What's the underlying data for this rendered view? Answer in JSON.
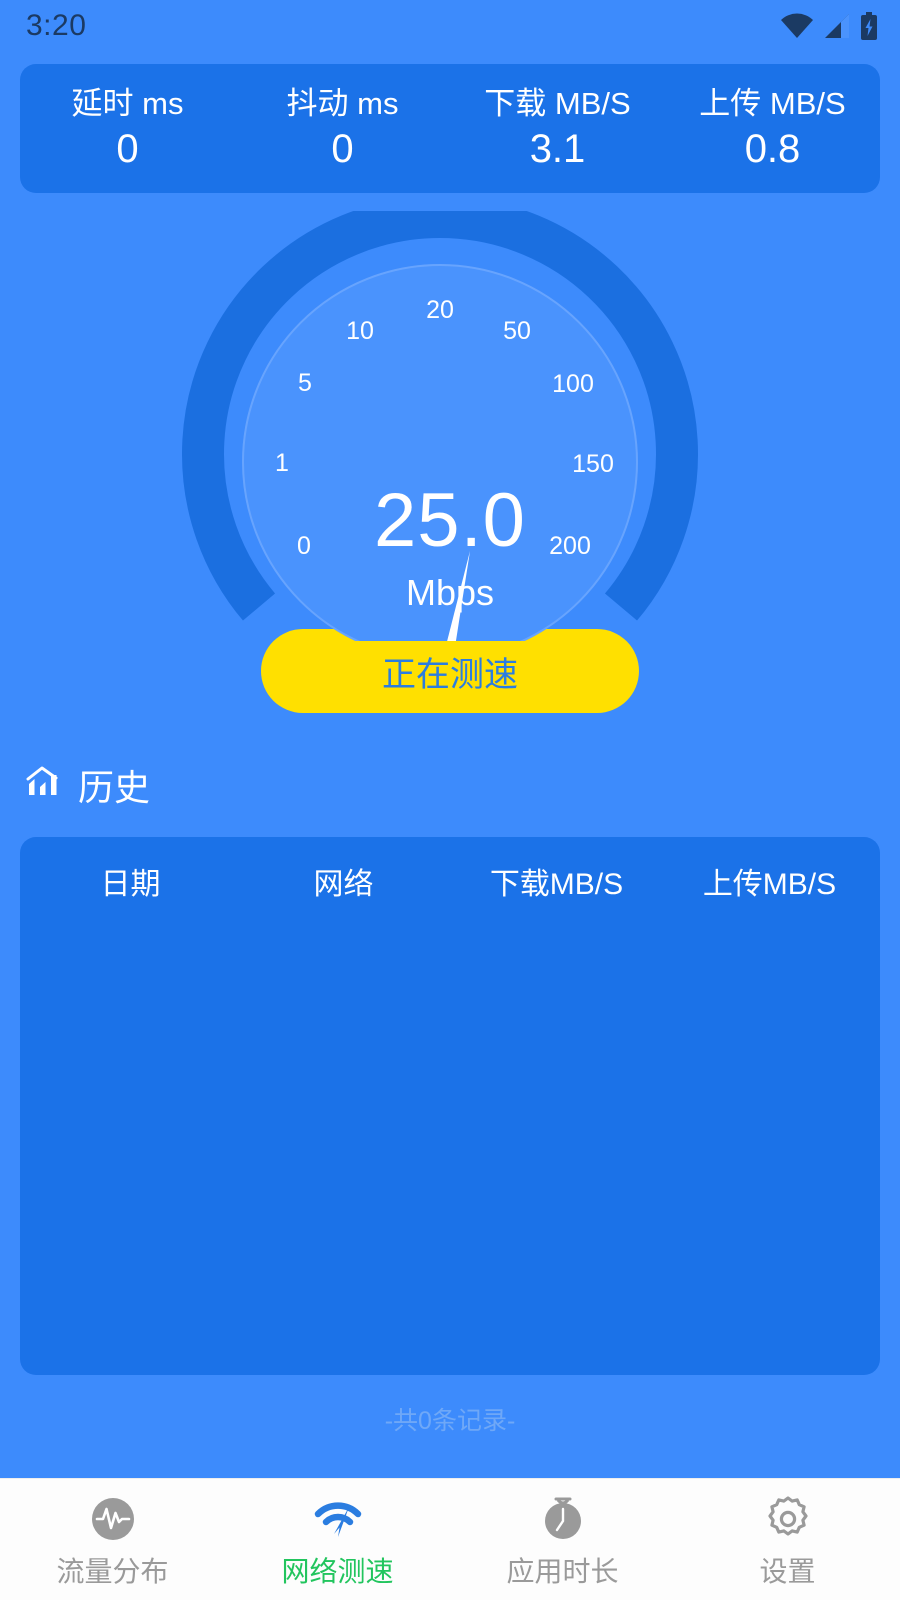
{
  "status_bar": {
    "clock": "3:20",
    "icons": [
      "wifi-icon",
      "cellular-signal-icon",
      "battery-charging-icon"
    ]
  },
  "colors": {
    "page_background": "#3d8bfc",
    "card_background": "#1b72e8",
    "accent_button": "#ffe000",
    "button_text": "#2b7de0",
    "active_tab": "#22c55e",
    "inactive_tab": "#9a9a9a",
    "gauge_arc": "#1b6fe0",
    "gauge_face": "#4a93fd",
    "needle": "#ffffff"
  },
  "stats": [
    {
      "label": "延时 ms",
      "value": "0"
    },
    {
      "label": "抖动 ms",
      "value": "0"
    },
    {
      "label": "下载 MB/S",
      "value": "3.1"
    },
    {
      "label": "上传 MB/S",
      "value": "0.8"
    }
  ],
  "gauge": {
    "value": "25.0",
    "unit": "Mbps",
    "ticks": [
      "0",
      "1",
      "5",
      "10",
      "20",
      "50",
      "100",
      "150",
      "200"
    ]
  },
  "action": {
    "button_label": "正在测速"
  },
  "history": {
    "icon": "bar-chart-icon",
    "title": "历史",
    "columns": [
      "日期",
      "网络",
      "下载MB/S",
      "上传MB/S"
    ],
    "rows": [],
    "record_count_text": "-共0条记录-"
  },
  "bottom_nav": [
    {
      "icon": "traffic-pulse-icon",
      "label": "流量分布",
      "active": false
    },
    {
      "icon": "speed-test-wifi-icon",
      "label": "网络测速",
      "active": true
    },
    {
      "icon": "stopwatch-icon",
      "label": "应用时长",
      "active": false
    },
    {
      "icon": "gear-icon",
      "label": "设置",
      "active": false
    }
  ]
}
